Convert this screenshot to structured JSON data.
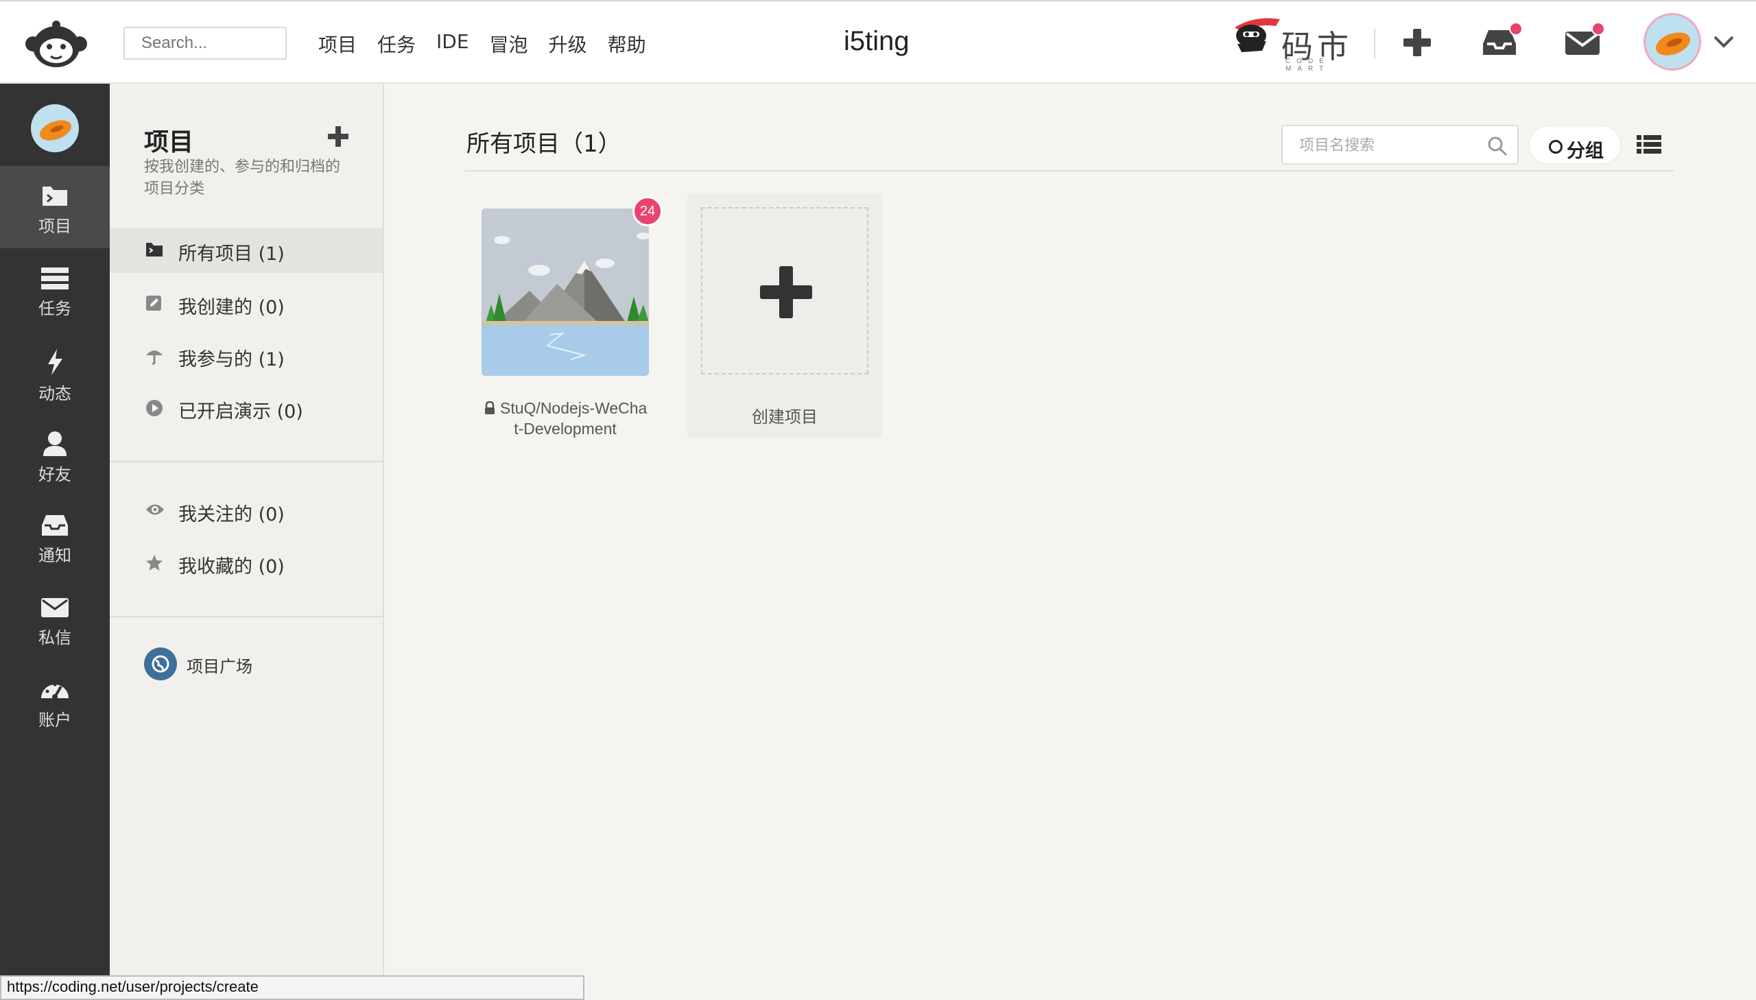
{
  "header": {
    "search_placeholder": "Search...",
    "nav": [
      "项目",
      "任务",
      "IDE",
      "冒泡",
      "升级",
      "帮助"
    ],
    "brand_name": "i5ting",
    "codemart_cn": "码市",
    "codemart_en": "CODE MART"
  },
  "leftbar": {
    "items": [
      {
        "label": "项目",
        "icon": "folder-icon"
      },
      {
        "label": "任务",
        "icon": "tasks-icon"
      },
      {
        "label": "动态",
        "icon": "lightning-icon"
      },
      {
        "label": "好友",
        "icon": "person-icon"
      },
      {
        "label": "通知",
        "icon": "inbox-icon"
      },
      {
        "label": "私信",
        "icon": "envelope-icon"
      },
      {
        "label": "账户",
        "icon": "dashboard-icon"
      }
    ]
  },
  "panel": {
    "title": "项目",
    "description": "按我创建的、参与的和归档的项目分类",
    "items": [
      {
        "label": "所有项目 (1)",
        "icon": "folder-icon"
      },
      {
        "label": "我创建的 (0)",
        "icon": "edit-icon"
      },
      {
        "label": "我参与的 (1)",
        "icon": "umbrella-icon"
      },
      {
        "label": "已开启演示 (0)",
        "icon": "play-icon"
      },
      {
        "label": "我关注的 (0)",
        "icon": "eye-icon"
      },
      {
        "label": "我收藏的 (0)",
        "icon": "star-icon"
      }
    ],
    "square_label": "项目广场"
  },
  "main": {
    "title": "所有项目（1）",
    "search_placeholder": "项目名搜索",
    "group_label": "分组",
    "projects": [
      {
        "name": "StuQ/Nodejs-WeChat-Development",
        "badge": "24",
        "private": true
      }
    ],
    "create_label": "创建项目"
  },
  "status_url": "https://coding.net/user/projects/create",
  "colors": {
    "sidebar_bg": "#333333",
    "panel_bg": "#f1f0ec",
    "badge": "#e8446f",
    "globe": "#3f6f9b"
  }
}
